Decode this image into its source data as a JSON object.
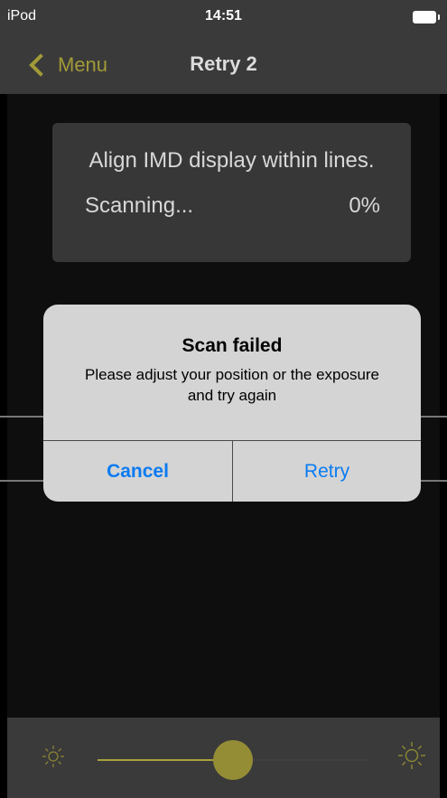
{
  "status_bar": {
    "carrier": "iPod",
    "time": "14:51"
  },
  "nav": {
    "back_label": "Menu",
    "title": "Retry 2"
  },
  "scan_box": {
    "instruction": "Align IMD display within lines.",
    "status": "Scanning...",
    "progress": "0%"
  },
  "alert": {
    "title": "Scan failed",
    "message": "Please adjust your position or the exposure and try again",
    "cancel_label": "Cancel",
    "retry_label": "Retry"
  },
  "exposure_slider": {
    "value_fraction": 0.5
  },
  "colors": {
    "accent": "#a29a37",
    "button_blue": "#0a7bf2",
    "bar_bg": "#3a3a3a"
  }
}
